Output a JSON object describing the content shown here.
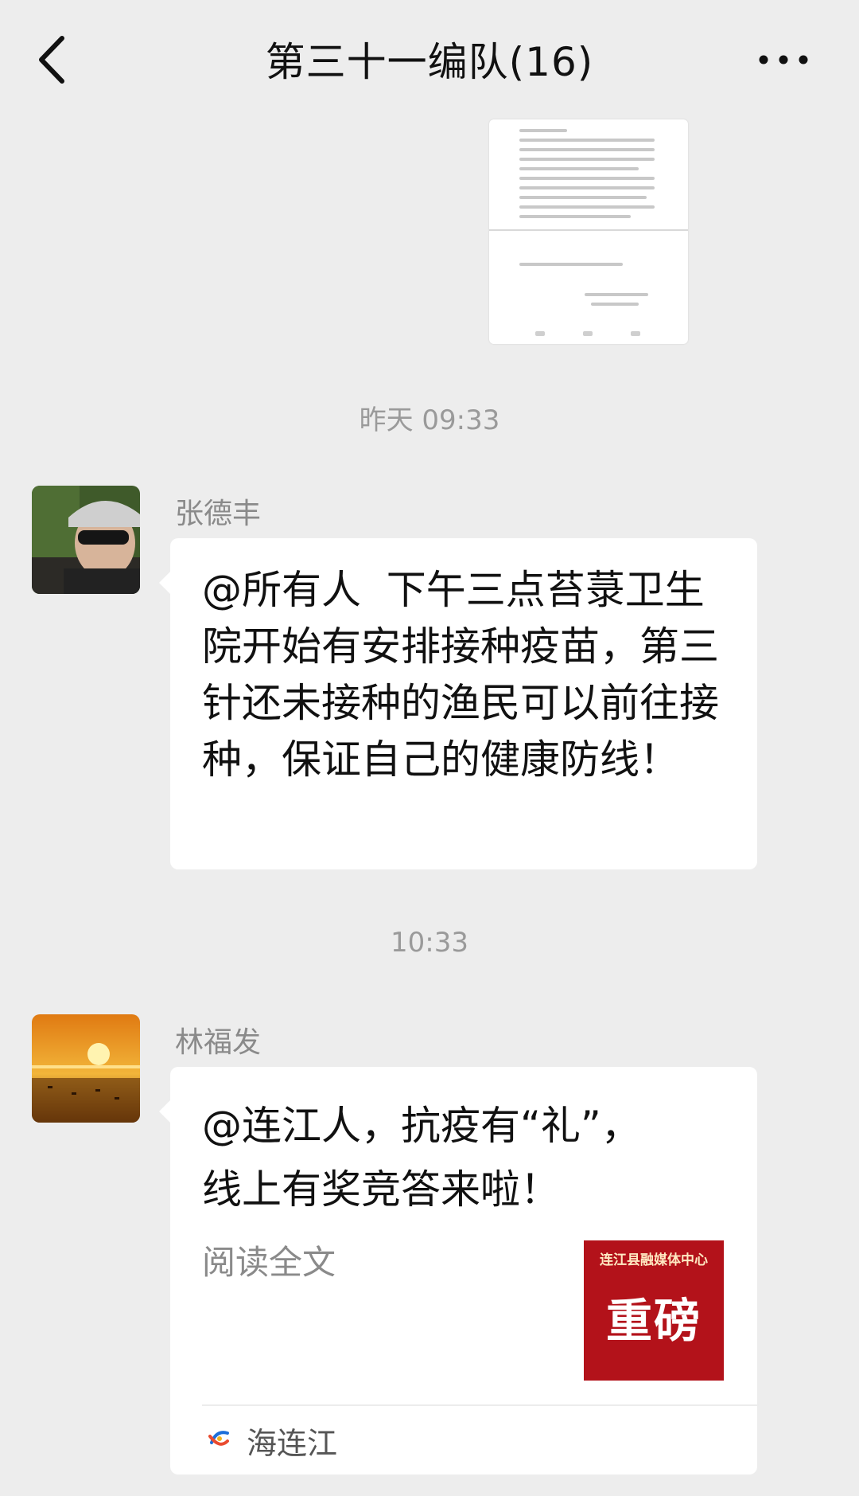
{
  "header": {
    "title": "第三十一编队(16)",
    "back_icon": "chevron-left-icon",
    "more_icon": "more-dots-icon"
  },
  "chat": {
    "timestamps": [
      "昨天 09:33",
      "10:33"
    ],
    "messages": [
      {
        "sender": "张德丰",
        "type": "text",
        "text": "@所有人  下午三点苔菉卫生院开始有安排接种疫苗，第三针还未接种的渔民可以前往接种，保证自己的健康防线！"
      },
      {
        "sender": "林福发",
        "type": "link",
        "title": "@连江人，抗疫有“礼”，\n线上有奖竞答来啦！",
        "description": "阅读全文",
        "thumbnail_top": "连江县融媒体中心",
        "thumbnail_main": "重磅",
        "source": "海连江"
      }
    ]
  },
  "colors": {
    "background": "#ededed",
    "bubble": "#ffffff",
    "thumbnail": "#b3121a"
  }
}
